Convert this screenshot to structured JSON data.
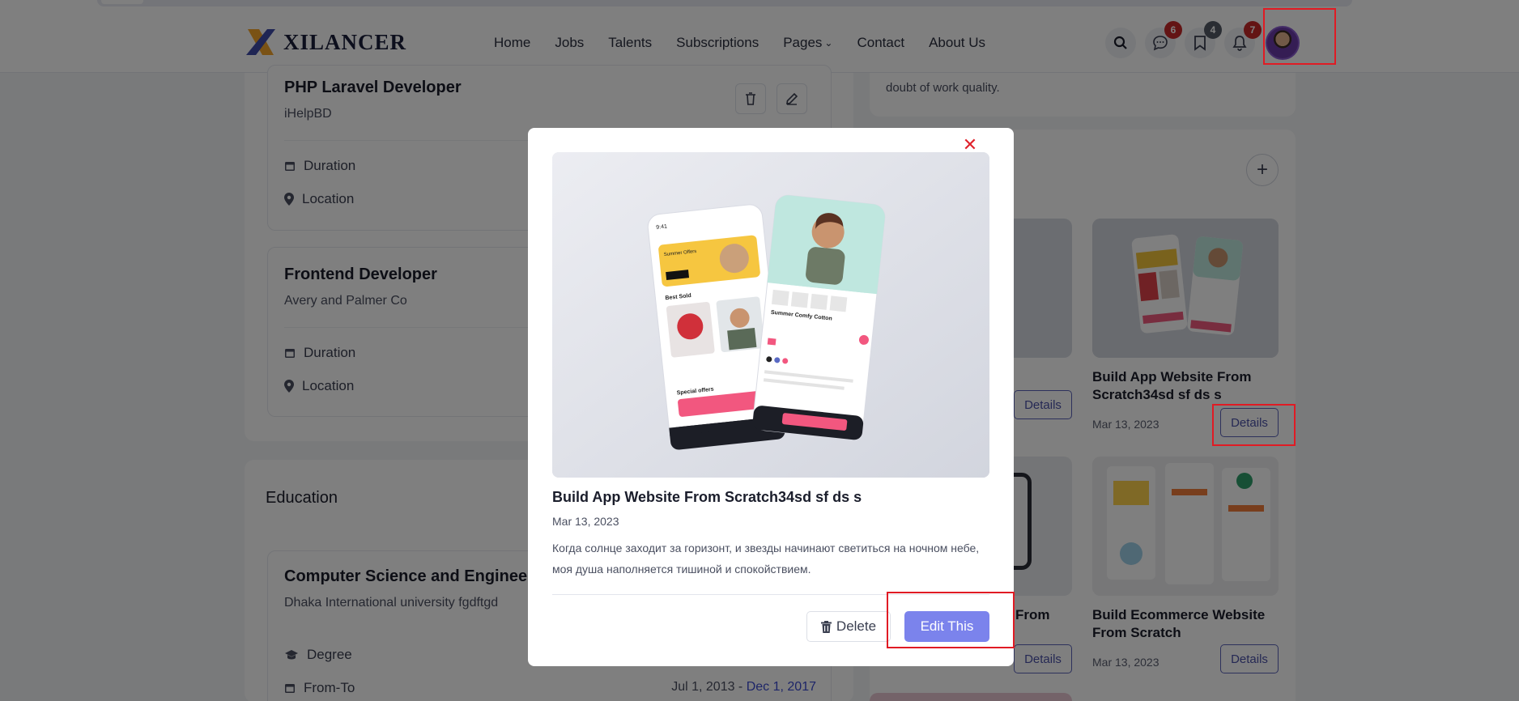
{
  "header": {
    "logo_text": "XILANCER",
    "nav": [
      "Home",
      "Jobs",
      "Talents",
      "Subscriptions",
      "Pages",
      "Contact",
      "About Us"
    ],
    "badges": {
      "messages": "6",
      "bookmarks": "4",
      "notifications": "7"
    },
    "badge_colors": {
      "messages": "#c62828",
      "bookmarks": "#555b66",
      "notifications": "#c62828"
    }
  },
  "experience": [
    {
      "title": "PHP Laravel Developer",
      "company": "iHelpBD",
      "duration_label": "Duration",
      "location_label": "Location"
    },
    {
      "title": "Frontend Developer",
      "company": "Avery and Palmer Co",
      "duration_label": "Duration",
      "location_label": "Location"
    }
  ],
  "education": {
    "heading": "Education",
    "item": {
      "title": "Computer Science and Engineer",
      "institution": "Dhaka International university fgdftgd",
      "degree_label": "Degree",
      "fromto_label": "From-To",
      "from": "Jul 1, 2013 -",
      "to": "Dec 1, 2017"
    }
  },
  "about": {
    "snippet": "doubt of work quality."
  },
  "projects": {
    "details_label": "Details",
    "items": [
      {
        "title": "Build App Website From Scratch34sd sf ds s",
        "date": "Mar 13, 2023"
      },
      {
        "title": "From",
        "date": ""
      },
      {
        "title": "Build Ecommerce Website From Scratch",
        "date": "Mar 13, 2023"
      }
    ]
  },
  "modal": {
    "title": "Build App Website From Scratch34sd sf ds s",
    "date": "Mar 13, 2023",
    "description": "Когда солнце заходит за горизонт, и звезды начинают светиться на ночном небе, моя душа наполняется тишиной и спокойствием.",
    "delete_label": "Delete",
    "edit_label": "Edit This",
    "image_labels": {
      "summer_offers": "Summer Offers",
      "best_sold": "Best Sold",
      "special_offers": "Special offers",
      "product_name": "Summer Comfy Cotton",
      "time": "9:41"
    }
  },
  "colors": {
    "accent": "#7b83ec",
    "highlight": "#e01b24",
    "close": "#e0242d"
  }
}
